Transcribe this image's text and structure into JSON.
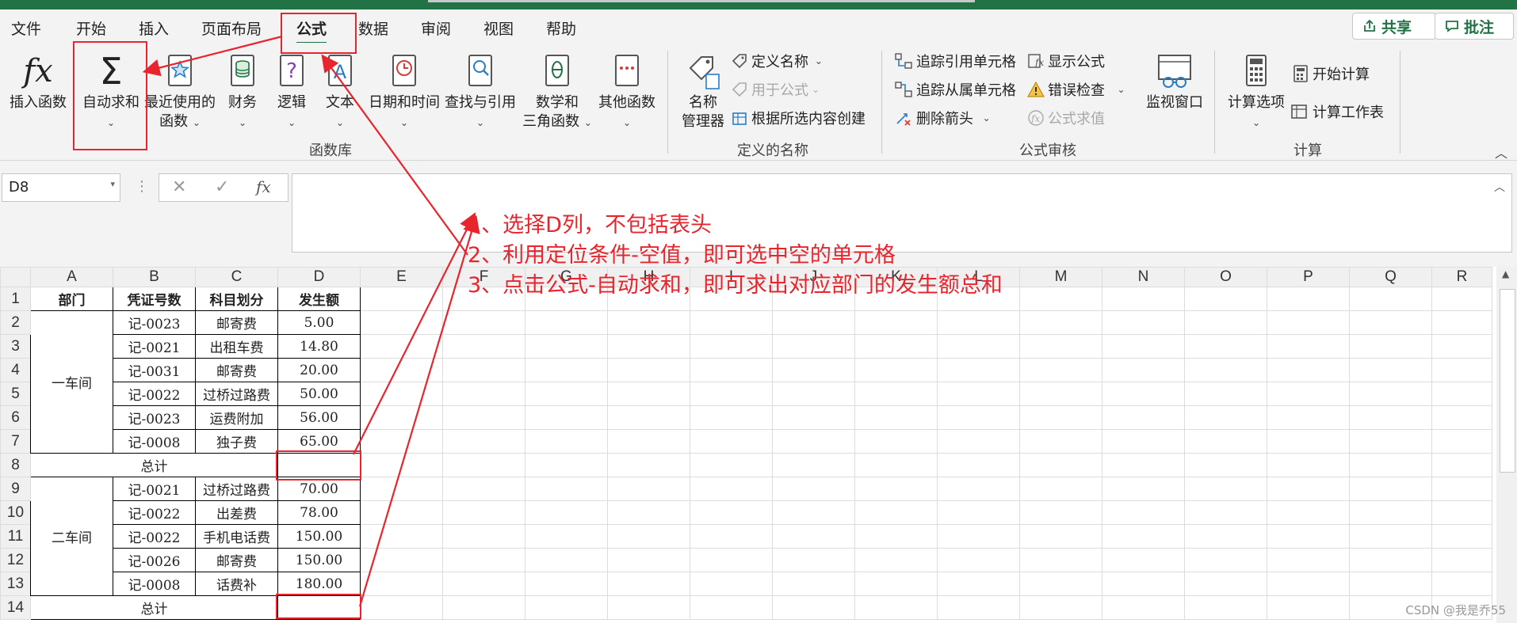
{
  "menu": {
    "tabs": [
      "文件",
      "开始",
      "插入",
      "页面布局",
      "公式",
      "数据",
      "审阅",
      "视图",
      "帮助"
    ],
    "active_tab": "公式",
    "share_label": "共享",
    "comment_label": "批注",
    "accent_color": "#217346"
  },
  "ribbon": {
    "func_library": {
      "insert_function": "插入函数",
      "autosum": "自动求和",
      "recent_line1": "最近使用的",
      "recent_line2": "函数",
      "financial": "财务",
      "logical": "逻辑",
      "text": "文本",
      "datetime": "日期和时间",
      "lookup": "查找与引用",
      "math_line1": "数学和",
      "math_line2": "三角函数",
      "more": "其他函数",
      "group_label": "函数库"
    },
    "defined_names": {
      "name_manager_line1": "名称",
      "name_manager_line2": "管理器",
      "define_name": "定义名称",
      "use_in_formula": "用于公式",
      "create_from_selection": "根据所选内容创建",
      "group_label": "定义的名称"
    },
    "auditing": {
      "trace_precedents": "追踪引用单元格",
      "trace_dependents": "追踪从属单元格",
      "remove_arrows": "删除箭头",
      "show_formulas": "显示公式",
      "error_checking": "错误检查",
      "evaluate_formula": "公式求值",
      "watch_window": "监视窗口",
      "group_label": "公式审核"
    },
    "calculation": {
      "calc_options": "计算选项",
      "calc_now": "开始计算",
      "calc_sheet": "计算工作表",
      "group_label": "计算"
    }
  },
  "formula_bar": {
    "name_box": "D8",
    "fx_label": "fx",
    "formula_value": ""
  },
  "sheet": {
    "columns": [
      "A",
      "B",
      "C",
      "D",
      "E",
      "F",
      "G",
      "H",
      "I",
      "J",
      "K",
      "L",
      "M",
      "N",
      "O",
      "P",
      "Q",
      "R"
    ],
    "rows": [
      "1",
      "2",
      "3",
      "4",
      "5",
      "6",
      "7",
      "8",
      "9",
      "10",
      "11",
      "12",
      "13",
      "14"
    ],
    "header": [
      "部门",
      "凭证号数",
      "科目划分",
      "发生额"
    ],
    "dept1": "一车间",
    "dept2": "二车间",
    "total_label": "总计",
    "data1": [
      [
        "记-0023",
        "邮寄费",
        "5.00"
      ],
      [
        "记-0021",
        "出租车费",
        "14.80"
      ],
      [
        "记-0031",
        "邮寄费",
        "20.00"
      ],
      [
        "记-0022",
        "过桥过路费",
        "50.00"
      ],
      [
        "记-0023",
        "运费附加",
        "56.00"
      ],
      [
        "记-0008",
        "独子费",
        "65.00"
      ]
    ],
    "data2": [
      [
        "记-0021",
        "过桥过路费",
        "70.00"
      ],
      [
        "记-0022",
        "出差费",
        "78.00"
      ],
      [
        "记-0022",
        "手机电话费",
        "150.00"
      ],
      [
        "记-0026",
        "邮寄费",
        "150.00"
      ],
      [
        "记-0008",
        "话费补",
        "180.00"
      ]
    ]
  },
  "annotations": {
    "step1": "1、选择D列，不包括表头",
    "step2": "2、利用定位条件-空值，即可选中空的单元格",
    "step3": "3、点击公式-自动求和，即可求出对应部门的发生额总和",
    "color": "#e8242c"
  },
  "watermark": "CSDN @我是乔55"
}
